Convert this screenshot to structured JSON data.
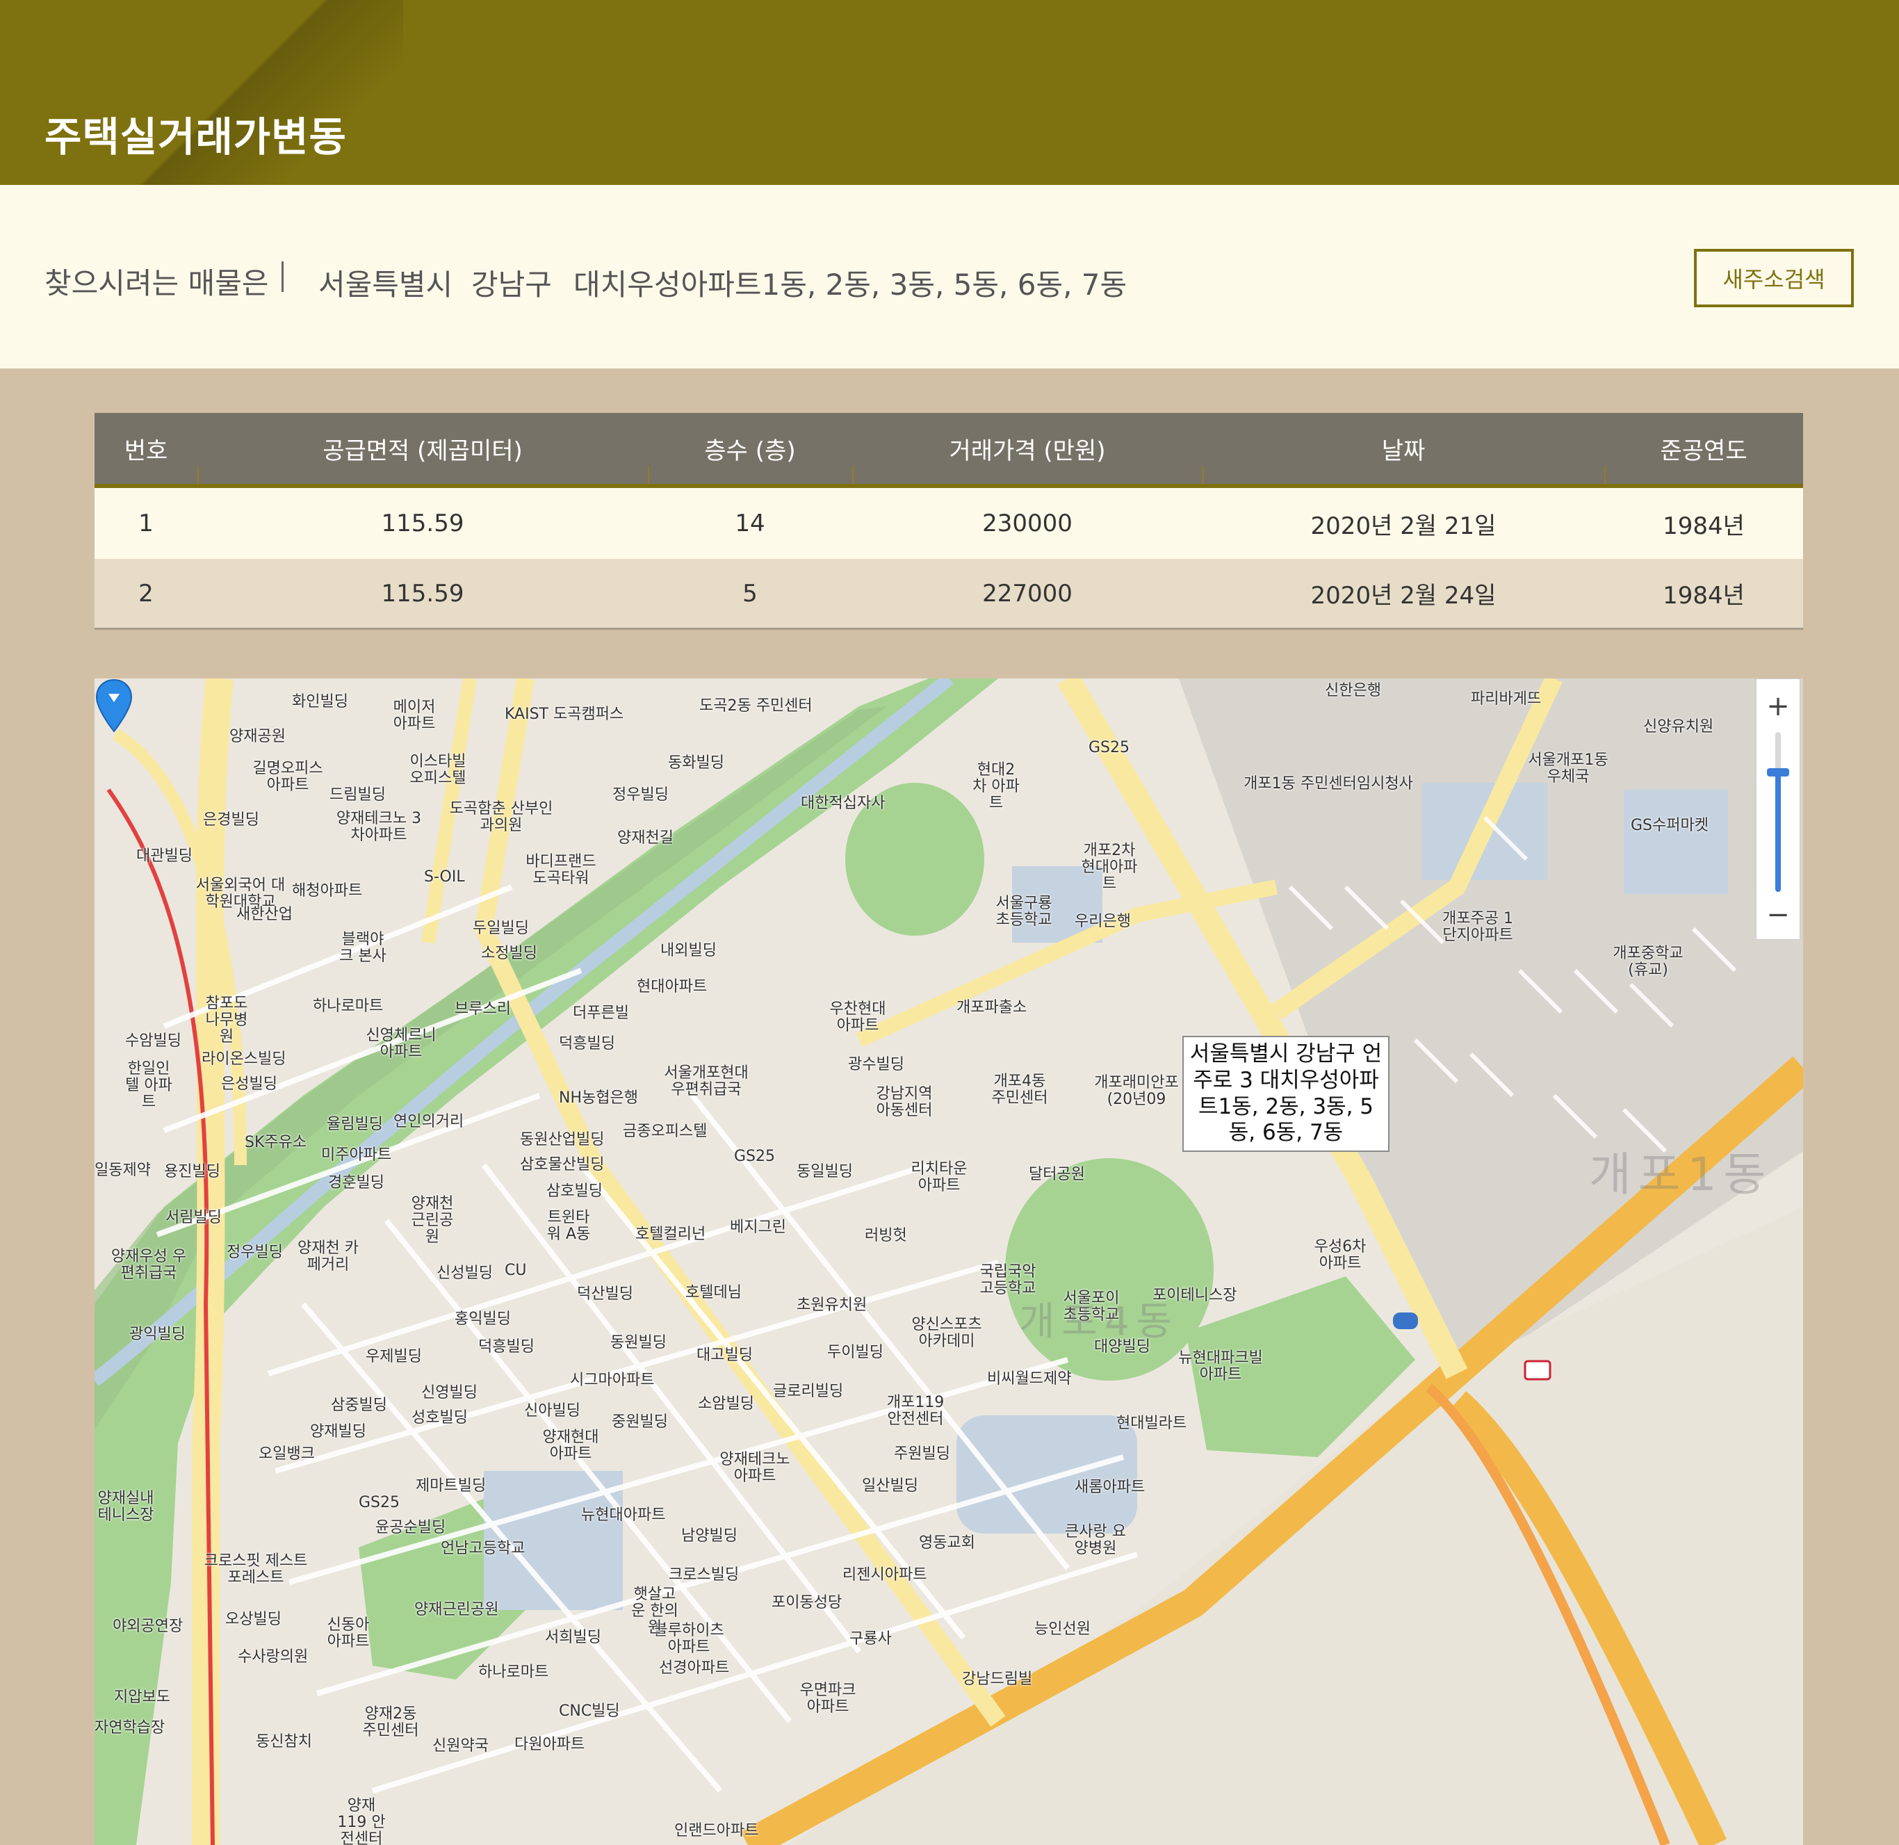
{
  "header": {
    "title": "주택실거래가변동"
  },
  "search": {
    "label": "찾으시려는 매물은",
    "city": "서울특별시",
    "district": "강남구",
    "complex": "대치우성아파트1동, 2동, 3동, 5동, 6동, 7동",
    "new_search_button": "새주소검색"
  },
  "table": {
    "headers": [
      "번호",
      "공급면적 (제곱미터)",
      "층수 (층)",
      "거래가격 (만원)",
      "날짜",
      "준공연도"
    ],
    "rows": [
      [
        "1",
        "115.59",
        "14",
        "230000",
        "2020년 2월 21일",
        "1984년"
      ],
      [
        "2",
        "115.59",
        "5",
        "227000",
        "2020년 2월 24일",
        "1984년"
      ]
    ]
  },
  "map": {
    "info_window": "서울특별시 강남구 언주로 3 대치우성아파트1동, 2동, 3동, 5동, 6동, 7동",
    "zoom_in": "+",
    "zoom_out": "−",
    "area_labels": [
      "개포1동",
      "개포4동"
    ],
    "places": {
      "p1": "도곡2동 주민센터",
      "p2": "KAIST 도곡캠퍼스",
      "p3": "동화빌딩",
      "p4": "정우빌딩",
      "p5": "양재천길",
      "p6": "대한적십자사",
      "p7": "현대2차 아파트",
      "p8": "GS25",
      "p9": "신한은행",
      "p10": "파리바게뜨",
      "p11": "신양유치원",
      "p12": "서울개포1동 우체국",
      "p13": "개포1동 주민센터임시청사",
      "p14": "GS수퍼마켓",
      "p15": "개포2차 현대아파트",
      "p16": "서울구룡 초등학교",
      "p17": "우리은행",
      "p18": "개포주공 1단지아파트",
      "p19": "개포중학교 (휴교)",
      "p20": "개포파출소",
      "p21": "우찬현대 아파트",
      "p22": "개포4동 주민센터",
      "p23": "광수빌딩",
      "p24": "강남지역 아동센터",
      "p25": "서울개포현대 우편취급국",
      "p26": "NH농협은행",
      "p27": "금종오피스텔",
      "p28": "GS25",
      "p29": "동일빌딩",
      "p30": "리치타운 아파트",
      "p31": "달터공원",
      "p32": "우성6차 아파트",
      "p33": "국립국악 고등학교",
      "p34": "서울포이 초등학교",
      "p35": "포이테니스장",
      "p36": "양신스포츠 아카데미",
      "p37": "대양빌딩",
      "p38": "뉴현대파크빌 아파트",
      "p39": "비씨월드제약",
      "p40": "개포119 안전센터",
      "p41": "현대빌라트",
      "p42": "주원빌딩",
      "p43": "일산빌딩",
      "p44": "새롬아파트",
      "p45": "영동교회",
      "p46": "큰사랑 요양병원",
      "p47": "리젠시아파트",
      "p48": "포이동성당",
      "p49": "구룡사",
      "p50": "능인선원",
      "p51": "강남드림빌",
      "p52": "우면파크 아파트",
      "p53": "선경아파트",
      "p54": "블루하이츠 아파트",
      "p55": "CNC빌딩",
      "p56": "다원아파트",
      "p57": "인랜드아파트",
      "p58": "하나로마트",
      "p59": "서희빌딩",
      "p60": "햇살고운 한의원",
      "p61": "크로스빌딩",
      "p62": "남양빌딩",
      "p63": "뉴현대아파트",
      "p64": "양재테크노 아파트",
      "p65": "소암빌딩",
      "p66": "글로리빌딩",
      "p67": "두이빌딩",
      "p68": "대고빌딩",
      "p69": "동원빌딩",
      "p70": "초원유치원",
      "p71": "호텔데님",
      "p72": "호텔컬리넌",
      "p73": "베지그린",
      "p74": "러빙헛",
      "p75": "덕산빌딩",
      "p76": "트윈타워 A동",
      "p77": "삼호빌딩",
      "p78": "삼호물산빌딩",
      "p79": "동원산업빌딩",
      "p80": "덕흥빌딩",
      "p81": "더푸른빌",
      "p82": "현대아파트",
      "p83": "내외빌딩",
      "p84": "두일빌딩",
      "p85": "소정빌딩",
      "p86": "브루스리",
      "p87": "바디프랜드 도곡타워",
      "p88": "도곡함춘 산부인과의원",
      "p89": "S-OIL",
      "p90": "이스타빌 오피스텔",
      "p91": "메이저 아파트",
      "p92": "화인빌딩",
      "p93": "양재공원",
      "p94": "길명오피스 아파트",
      "p95": "드림빌딩",
      "p96": "양재테크노 3차아파트",
      "p97": "은경빌딩",
      "p98": "대관빌딩",
      "p99": "서울외국어 대학원대학교",
      "p100": "해청아파트",
      "p101": "새한산업",
      "p102": "블랙야크 본사",
      "p103": "하나로마트",
      "p104": "참포도 나무병원",
      "p105": "수암빌딩",
      "p106": "한일인텔 아파트",
      "p107": "라이온스빌딩",
      "p108": "은성빌딩",
      "p109": "신영체르니 아파트",
      "p110": "율림빌딩",
      "p111": "연인의거리",
      "p112": "SK주유소",
      "p113": "미주아파트",
      "p114": "경훈빌딩",
      "p115": "일동제약",
      "p116": "용진빌딩",
      "p117": "서림빌딩",
      "p118": "양재천 근린공원",
      "p119": "양재우성 우편취급국",
      "p120": "정우빌딩",
      "p121": "양재천 카페거리",
      "p122": "신성빌딩",
      "p123": "CU",
      "p124": "광익빌딩",
      "p125": "홍익빌딩",
      "p126": "덕흥빌딩",
      "p127": "우제빌딩",
      "p128": "신영빌딩",
      "p129": "성호빌딩",
      "p130": "삼중빌딩",
      "p131": "양재빌딩",
      "p132": "시그마아파트",
      "p133": "신아빌딩",
      "p134": "양재현대 아파트",
      "p135": "중원빌딩",
      "p136": "오일뱅크",
      "p137": "제마트빌딩",
      "p138": "GS25",
      "p139": "윤공순빌딩",
      "p140": "언남고등학교",
      "p141": "크로스핏 제스트포레스트",
      "p142": "양재근린공원",
      "p143": "오상빌딩",
      "p144": "신동아 아파트",
      "p145": "수사랑의원",
      "p146": "양재2동 주민센터",
      "p147": "동신참치",
      "p148": "양재119 안전센터",
      "p149": "신원약국",
      "p150": "야외공연장",
      "p151": "지압보도",
      "p152": "자연학습장",
      "p153": "양재실내 테니스장",
      "p154": "개포래미안포 (20년09"
    }
  }
}
